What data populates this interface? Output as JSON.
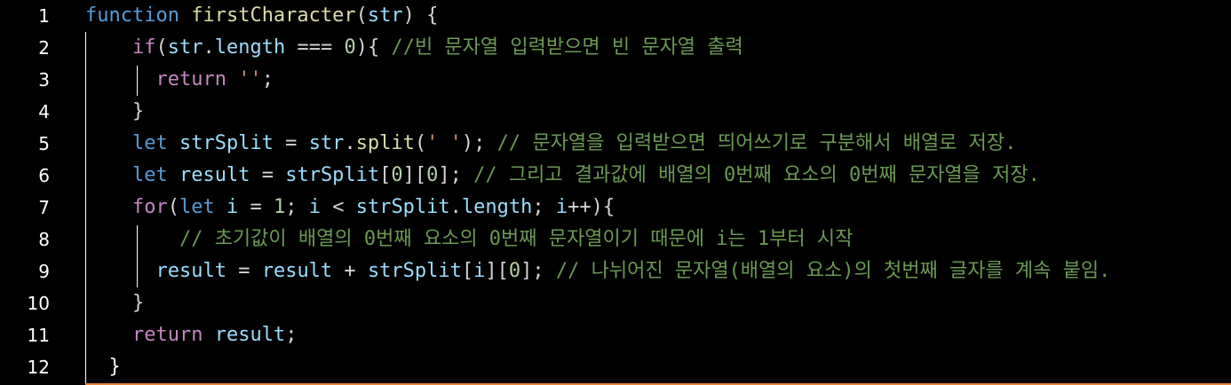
{
  "line_numbers": [
    "1",
    "2",
    "3",
    "4",
    "5",
    "6",
    "7",
    "8",
    "9",
    "10",
    "11",
    "12"
  ],
  "lines": [
    {
      "segments": [
        {
          "t": "function ",
          "c": "kwb"
        },
        {
          "t": "firstCharacter",
          "c": "fn"
        },
        {
          "t": "(",
          "c": "plain"
        },
        {
          "t": "str",
          "c": "var"
        },
        {
          "t": ") {",
          "c": "plain"
        }
      ]
    },
    {
      "segments": [
        {
          "t": "    if",
          "c": "kw"
        },
        {
          "t": "(",
          "c": "plain"
        },
        {
          "t": "str",
          "c": "var"
        },
        {
          "t": ".",
          "c": "plain"
        },
        {
          "t": "length",
          "c": "var"
        },
        {
          "t": " === ",
          "c": "plain"
        },
        {
          "t": "0",
          "c": "num"
        },
        {
          "t": "){ ",
          "c": "plain"
        },
        {
          "t": "//빈 문자열 입력받으면 빈 문자열 출력",
          "c": "cmt"
        }
      ]
    },
    {
      "segments": [
        {
          "t": "      return ",
          "c": "kw"
        },
        {
          "t": "''",
          "c": "str"
        },
        {
          "t": ";",
          "c": "plain"
        }
      ]
    },
    {
      "segments": [
        {
          "t": "    }",
          "c": "plain"
        }
      ]
    },
    {
      "segments": [
        {
          "t": "    let ",
          "c": "kwb"
        },
        {
          "t": "strSplit",
          "c": "var"
        },
        {
          "t": " = ",
          "c": "plain"
        },
        {
          "t": "str",
          "c": "var"
        },
        {
          "t": ".",
          "c": "plain"
        },
        {
          "t": "split",
          "c": "fn"
        },
        {
          "t": "(",
          "c": "plain"
        },
        {
          "t": "' '",
          "c": "str"
        },
        {
          "t": "); ",
          "c": "plain"
        },
        {
          "t": "// 문자열을 입력받으면 띄어쓰기로 구분해서 배열로 저장.",
          "c": "cmt"
        }
      ]
    },
    {
      "segments": [
        {
          "t": "    let ",
          "c": "kwb"
        },
        {
          "t": "result",
          "c": "var"
        },
        {
          "t": " = ",
          "c": "plain"
        },
        {
          "t": "strSplit",
          "c": "var"
        },
        {
          "t": "[",
          "c": "plain"
        },
        {
          "t": "0",
          "c": "num"
        },
        {
          "t": "][",
          "c": "plain"
        },
        {
          "t": "0",
          "c": "num"
        },
        {
          "t": "]; ",
          "c": "plain"
        },
        {
          "t": "// 그리고 결과값에 배열의 0번째 요소의 0번째 문자열을 저장.",
          "c": "cmt"
        }
      ]
    },
    {
      "segments": [
        {
          "t": "    for",
          "c": "kw"
        },
        {
          "t": "(",
          "c": "plain"
        },
        {
          "t": "let ",
          "c": "kwb"
        },
        {
          "t": "i",
          "c": "var"
        },
        {
          "t": " = ",
          "c": "plain"
        },
        {
          "t": "1",
          "c": "num"
        },
        {
          "t": "; ",
          "c": "plain"
        },
        {
          "t": "i",
          "c": "var"
        },
        {
          "t": " < ",
          "c": "plain"
        },
        {
          "t": "strSplit",
          "c": "var"
        },
        {
          "t": ".",
          "c": "plain"
        },
        {
          "t": "length",
          "c": "var"
        },
        {
          "t": "; ",
          "c": "plain"
        },
        {
          "t": "i",
          "c": "var"
        },
        {
          "t": "++){",
          "c": "plain"
        }
      ]
    },
    {
      "segments": [
        {
          "t": "        // 초기값이 배열의 0번째 요소의 0번째 문자열이기 때문에 i는 1부터 시작",
          "c": "cmt"
        }
      ]
    },
    {
      "segments": [
        {
          "t": "      result",
          "c": "var"
        },
        {
          "t": " = ",
          "c": "plain"
        },
        {
          "t": "result",
          "c": "var"
        },
        {
          "t": " + ",
          "c": "plain"
        },
        {
          "t": "strSplit",
          "c": "var"
        },
        {
          "t": "[",
          "c": "plain"
        },
        {
          "t": "i",
          "c": "var"
        },
        {
          "t": "][",
          "c": "plain"
        },
        {
          "t": "0",
          "c": "num"
        },
        {
          "t": "]; ",
          "c": "plain"
        },
        {
          "t": "// 나뉘어진 문자열(배열의 요소)의 첫번째 글자를 계속 붙임.",
          "c": "cmt"
        }
      ]
    },
    {
      "segments": [
        {
          "t": "    }",
          "c": "plain"
        }
      ]
    },
    {
      "segments": [
        {
          "t": "    return ",
          "c": "kw"
        },
        {
          "t": "result",
          "c": "var"
        },
        {
          "t": ";",
          "c": "plain"
        }
      ]
    },
    {
      "segments": [
        {
          "t": "  }",
          "c": "white"
        }
      ]
    }
  ],
  "theme": {
    "background": "#000000",
    "accent_bar": "#e5843a"
  }
}
